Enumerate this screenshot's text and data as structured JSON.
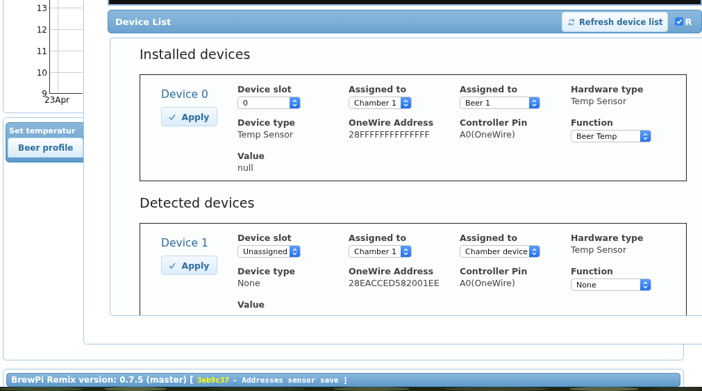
{
  "chart": {
    "y_ticks": [
      "13",
      "12",
      "11",
      "10",
      "9"
    ],
    "x_tick": "23Apr"
  },
  "temperature_panel": {
    "title": "Set temperatur",
    "tabs": [
      {
        "label": "Beer profile",
        "selected": true
      }
    ]
  },
  "dialog": {
    "title": "Device List",
    "refresh_button": "Refresh device list",
    "option": {
      "label": "R",
      "checked": true
    },
    "sections": [
      {
        "heading": "Installed devices",
        "devices": [
          {
            "name": "Device 0",
            "apply_button": "Apply",
            "fields": [
              {
                "label": "Device slot",
                "kind": "select",
                "value": "0"
              },
              {
                "label": "Assigned to",
                "kind": "select",
                "value": "Chamber 1"
              },
              {
                "label": "Assigned to",
                "kind": "select",
                "value": "Beer 1",
                "wide": true
              },
              {
                "label": "Hardware type",
                "kind": "text",
                "value": "Temp Sensor"
              },
              {
                "label": "Device type",
                "kind": "text",
                "value": "Temp Sensor"
              },
              {
                "label": "OneWire Address",
                "kind": "text",
                "value": "28FFFFFFFFFFFFFF"
              },
              {
                "label": "Controller Pin",
                "kind": "text",
                "value": "A0(OneWire)"
              },
              {
                "label": "Function",
                "kind": "select",
                "value": "Beer Temp",
                "wide": true
              },
              {
                "label": "Value",
                "kind": "text",
                "value": "null"
              }
            ]
          }
        ]
      },
      {
        "heading": "Detected devices",
        "devices": [
          {
            "name": "Device 1",
            "apply_button": "Apply",
            "fields": [
              {
                "label": "Device slot",
                "kind": "select",
                "value": "Unassigned"
              },
              {
                "label": "Assigned to",
                "kind": "select",
                "value": "Chamber 1"
              },
              {
                "label": "Assigned to",
                "kind": "select",
                "value": "Chamber device",
                "wide": true
              },
              {
                "label": "Hardware type",
                "kind": "text",
                "value": "Temp Sensor"
              },
              {
                "label": "Device type",
                "kind": "text",
                "value": "None"
              },
              {
                "label": "OneWire Address",
                "kind": "text",
                "value": "28EACCED582001EE"
              },
              {
                "label": "Controller Pin",
                "kind": "text",
                "value": "A0(OneWire)"
              },
              {
                "label": "Function",
                "kind": "select",
                "value": "None",
                "wide": true
              },
              {
                "label": "Value",
                "kind": "text"
              }
            ]
          }
        ]
      }
    ]
  },
  "footer": {
    "version": "BrewPi Remix version: 0.7.5 (master) [",
    "commit": "3eb9c37",
    "message": "- Addresses sensor save ]"
  }
}
